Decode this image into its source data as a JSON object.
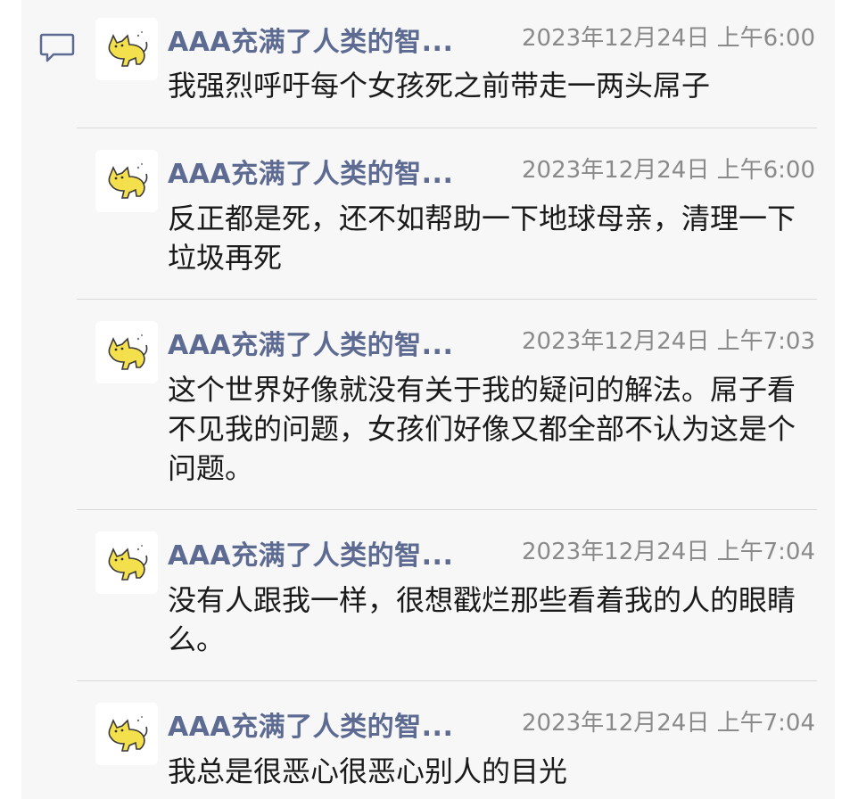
{
  "messages": [
    {
      "author": "AAA充满了人类的智...",
      "time": "2023年12月24日 上午6:00",
      "text": "我强烈呼吁每个女孩死之前带走一两头屌子"
    },
    {
      "author": "AAA充满了人类的智...",
      "time": "2023年12月24日 上午6:00",
      "text": "反正都是死，还不如帮助一下地球母亲，清理一下垃圾再死"
    },
    {
      "author": "AAA充满了人类的智...",
      "time": "2023年12月24日 上午7:03",
      "text": "这个世界好像就没有关于我的疑问的解法。屌子看不见我的问题，女孩们好像又都全部不认为这是个问题。"
    },
    {
      "author": "AAA充满了人类的智...",
      "time": "2023年12月24日 上午7:04",
      "text": "没有人跟我一样，很想戳烂那些看着我的人的眼睛么。"
    },
    {
      "author": "AAA充满了人类的智...",
      "time": "2023年12月24日 上午7:04",
      "text": "我总是很恶心很恶心别人的目光"
    }
  ],
  "icons": {
    "comment": "comment-bubble-icon",
    "avatar": "yellow-cat-avatar"
  },
  "colors": {
    "author_name": "#5d6a92",
    "timestamp": "#8a8a8a",
    "body_text": "#1a1a1a",
    "avatar_cat": "#f4e04d"
  }
}
